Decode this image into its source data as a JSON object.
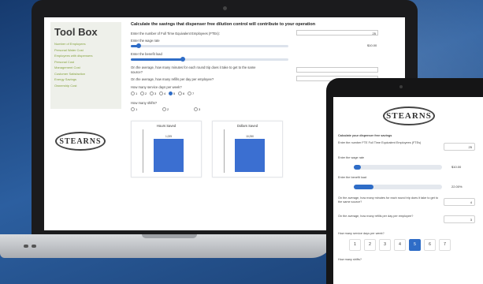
{
  "laptop": {
    "toolbox": {
      "title": "Tool Box",
      "items": [
        "Number of Employees",
        "Personal Water Cost",
        "Employees with dispensers",
        "Personal Cost",
        "Management Cost",
        "Customer Satisfaction",
        "Energy Savings",
        "Ownership Cost"
      ]
    },
    "logo": "STEARNS",
    "heading": "Calculate the savings that dispenser free dilution control will contribute to your operation",
    "q_employees": "Enter the number of Full Time Equivalent Employees (FTEs):",
    "employees_value": "25",
    "q_wage": "Enter the wage rate",
    "wage_value": "$10.00",
    "wage_fraction": 0.05,
    "q_benefit": "Enter the benefit load",
    "benefit_fraction": 0.33,
    "q_minutes": "On the average, how many minutes for each round trip does it take to get to the same",
    "q_minutes_2": "source?",
    "q_refills": "On the average, how many refills per day per employee?",
    "q_days": "How many service days per week?",
    "days": [
      "1",
      "2",
      "3",
      "4",
      "5",
      "6",
      "7"
    ],
    "selected_day": "5",
    "q_shifts": "How many shifts?",
    "shifts": [
      "1",
      "2",
      "3"
    ],
    "chart_data": [
      {
        "type": "bar",
        "title": "Hours Saved",
        "values": [
          1025
        ],
        "data_label": "1,025"
      },
      {
        "type": "bar",
        "title": "Dollars Saved",
        "values": [
          10250
        ],
        "data_label": "10,250"
      }
    ]
  },
  "tablet": {
    "logo": "STEARNS",
    "heading": "Calculate your dispenser free savings",
    "q_employees": "Enter the number FTE Full Time Equivalent Employees (FTEs)",
    "employees_value": "25",
    "q_wage": "Enter the wage rate",
    "wage_value": "$10.00",
    "wage_fraction": 0.08,
    "q_benefit": "Enter the benefit load",
    "benefit_value": "22.00%",
    "benefit_fraction": 0.22,
    "q_minutes": "On the average, how many minutes for each round trip does it take to get to the same source?",
    "minutes_value": "4",
    "q_refills": "On the average, how many refills per day per employee?",
    "refills_value": "3",
    "q_days": "How many service days per week?",
    "days": [
      "1",
      "2",
      "3",
      "4",
      "5",
      "6",
      "7"
    ],
    "selected_day": "5",
    "q_shifts": "How many shifts?"
  },
  "colors": {
    "accent": "#2f6dc7",
    "toolbox_link": "#86a33f",
    "background": "#2c5fa0"
  }
}
